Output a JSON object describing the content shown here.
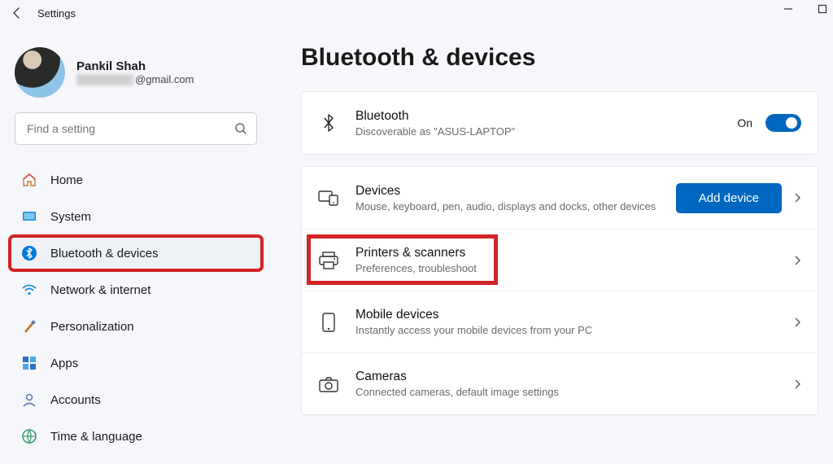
{
  "window": {
    "title": "Settings"
  },
  "profile": {
    "name": "Pankil Shah",
    "email_suffix": "@gmail.com"
  },
  "search": {
    "placeholder": "Find a setting"
  },
  "sidebar": {
    "items": [
      {
        "icon": "home-icon",
        "label": "Home"
      },
      {
        "icon": "system-icon",
        "label": "System"
      },
      {
        "icon": "bluetooth-icon",
        "label": "Bluetooth & devices",
        "active": true,
        "highlighted": true
      },
      {
        "icon": "wifi-icon",
        "label": "Network & internet"
      },
      {
        "icon": "brush-icon",
        "label": "Personalization"
      },
      {
        "icon": "apps-icon",
        "label": "Apps"
      },
      {
        "icon": "accounts-icon",
        "label": "Accounts"
      },
      {
        "icon": "time-icon",
        "label": "Time & language"
      }
    ]
  },
  "page": {
    "title": "Bluetooth & devices",
    "bluetooth": {
      "title": "Bluetooth",
      "subtitle": "Discoverable as \"ASUS-LAPTOP\"",
      "state_label": "On"
    },
    "rows": [
      {
        "icon": "devices-icon",
        "title": "Devices",
        "subtitle": "Mouse, keyboard, pen, audio, displays and docks, other devices",
        "action_button": "Add device"
      },
      {
        "icon": "printer-icon",
        "title": "Printers & scanners",
        "subtitle": "Preferences, troubleshoot",
        "highlighted": true
      },
      {
        "icon": "phone-icon",
        "title": "Mobile devices",
        "subtitle": "Instantly access your mobile devices from your PC"
      },
      {
        "icon": "camera-icon",
        "title": "Cameras",
        "subtitle": "Connected cameras, default image settings"
      }
    ]
  }
}
